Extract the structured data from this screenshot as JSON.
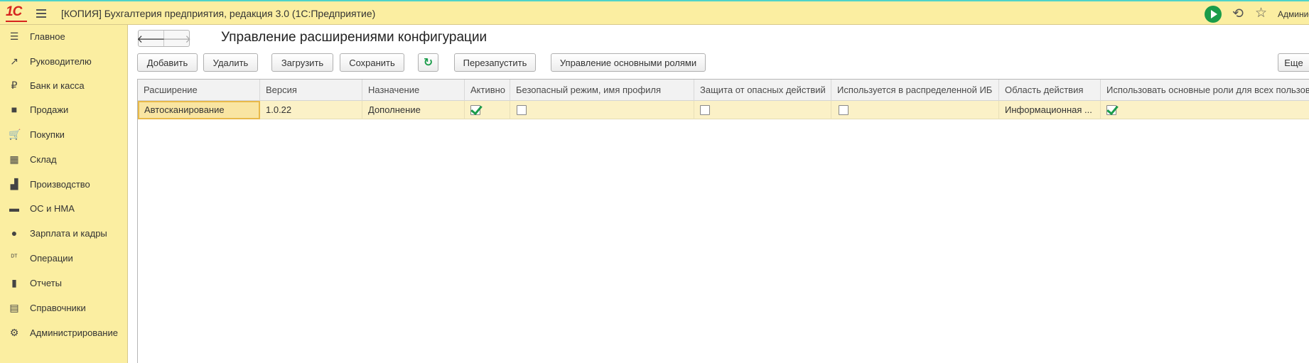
{
  "titlebar": {
    "logo": "1С",
    "title": "[КОПИЯ] Бухгалтерия предприятия, редакция 3.0  (1С:Предприятие)",
    "user": "Админис"
  },
  "sidebar": {
    "items": [
      {
        "label": "Главное",
        "icon": "list-icon",
        "glyph": "☰"
      },
      {
        "label": "Руководителю",
        "icon": "trend-icon",
        "glyph": "↗"
      },
      {
        "label": "Банк и касса",
        "icon": "coin-icon",
        "glyph": "₽"
      },
      {
        "label": "Продажи",
        "icon": "bag-icon",
        "glyph": "■"
      },
      {
        "label": "Покупки",
        "icon": "cart-icon",
        "glyph": "🛒"
      },
      {
        "label": "Склад",
        "icon": "warehouse-icon",
        "glyph": "▦"
      },
      {
        "label": "Производство",
        "icon": "factory-icon",
        "glyph": "▟"
      },
      {
        "label": "ОС и НМА",
        "icon": "truck-icon",
        "glyph": "▬"
      },
      {
        "label": "Зарплата и кадры",
        "icon": "person-icon",
        "glyph": "●"
      },
      {
        "label": "Операции",
        "icon": "dt-kt-icon",
        "glyph": "ᴰᵀ"
      },
      {
        "label": "Отчеты",
        "icon": "bar-chart-icon",
        "glyph": "▮"
      },
      {
        "label": "Справочники",
        "icon": "book-icon",
        "glyph": "▤"
      },
      {
        "label": "Администрирование",
        "icon": "gear-icon",
        "glyph": "⚙"
      }
    ]
  },
  "page": {
    "title": "Управление расширениями конфигурации",
    "nav_back": "🡐",
    "nav_forward": "🡒"
  },
  "toolbar": {
    "add": "Добавить",
    "delete": "Удалить",
    "load": "Загрузить",
    "save": "Сохранить",
    "refresh": "↻",
    "restart": "Перезапустить",
    "roles": "Управление основными ролями",
    "more": "Еще"
  },
  "table": {
    "columns": [
      "Расширение",
      "Версия",
      "Назначение",
      "Активно",
      "Безопасный режим, имя профиля",
      "Защита от опасных действий",
      "Используется в распределенной ИБ",
      "Область действия",
      "Использовать основные роли для всех пользователей"
    ],
    "rows": [
      {
        "name": "Автосканирование",
        "version": "1.0.22",
        "purpose": "Дополнение",
        "active": true,
        "safe_mode": false,
        "protection": false,
        "distributed": false,
        "scope": "Информационная ...",
        "use_main_roles": true
      }
    ]
  },
  "colors": {
    "panel_yellow": "#fbeea1",
    "row_highlight": "#fbf1c7",
    "accent_green": "#1a9c4a",
    "logo_red": "#d6241e"
  }
}
